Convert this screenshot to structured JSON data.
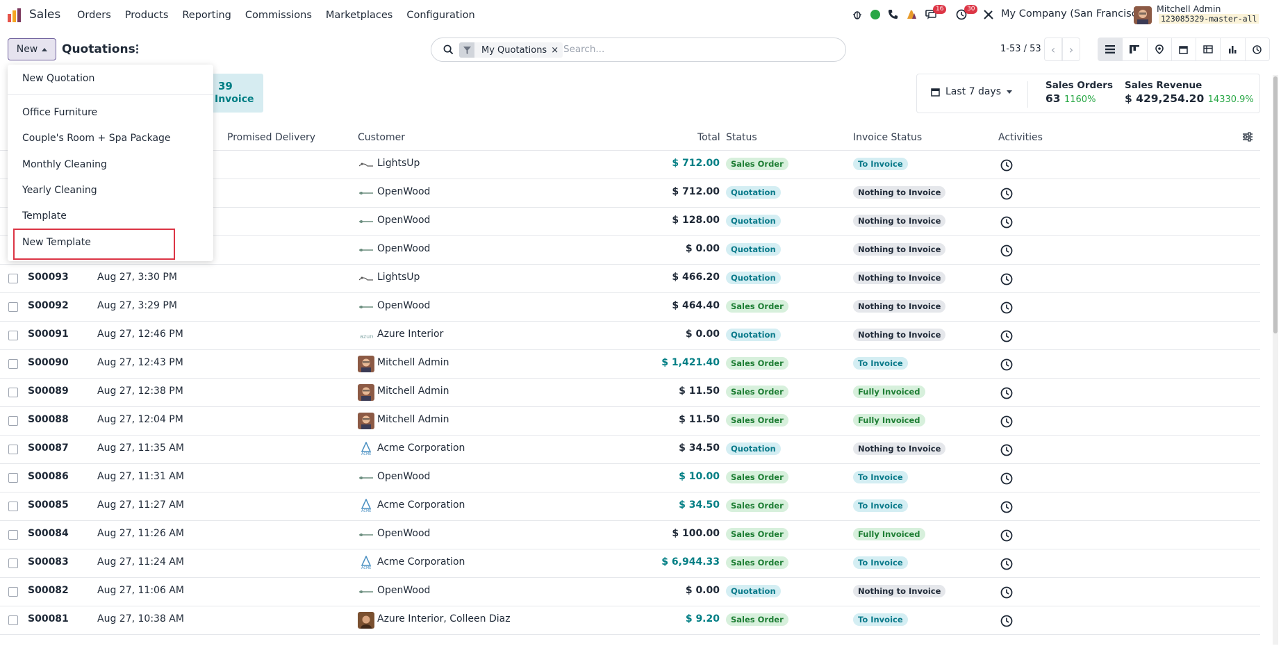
{
  "app": {
    "name": "Sales"
  },
  "menu": [
    "Orders",
    "Products",
    "Reporting",
    "Commissions",
    "Marketplaces",
    "Configuration"
  ],
  "systray": {
    "messages_count": "16",
    "activities_count": "30",
    "company": "My Company (San Francisco)",
    "user": "Mitchell Admin",
    "db": "123085329-master-all"
  },
  "control": {
    "new_label": "New",
    "title": "Quotations"
  },
  "search": {
    "facet": "My Quotations",
    "placeholder": "Search..."
  },
  "pager": {
    "text": "1-53 / 53"
  },
  "kpi": {
    "count": "39",
    "label": "Invoice"
  },
  "stats": {
    "date_filter": "Last 7 days",
    "orders_label": "Sales Orders",
    "orders_value": "63",
    "orders_pct": "1160%",
    "revenue_label": "Sales Revenue",
    "revenue_value": "$ 429,254.20",
    "revenue_pct": "14330.9%"
  },
  "columns": {
    "promised": "Promised Delivery",
    "customer": "Customer",
    "total": "Total",
    "status": "Status",
    "invoice_status": "Invoice Status",
    "activities": "Activities"
  },
  "dropdown": [
    "New Quotation",
    "Office Furniture",
    "Couple's Room + Spa Package",
    "Monthly Cleaning",
    "Yearly Cleaning",
    "Template",
    "New Template"
  ],
  "rows": [
    {
      "num": "",
      "date": "",
      "customer": "LightsUp",
      "logo": "lightsup",
      "total": "$ 712.00",
      "blue": true,
      "status": "Sales Order",
      "inv": "To Invoice"
    },
    {
      "num": "",
      "date": "",
      "customer": "OpenWood",
      "logo": "openwood",
      "total": "$ 712.00",
      "blue": false,
      "status": "Quotation",
      "inv": "Nothing to Invoice"
    },
    {
      "num": "",
      "date": "",
      "customer": "OpenWood",
      "logo": "openwood",
      "total": "$ 128.00",
      "blue": false,
      "status": "Quotation",
      "inv": "Nothing to Invoice"
    },
    {
      "num": "",
      "date": "",
      "customer": "OpenWood",
      "logo": "openwood",
      "total": "$ 0.00",
      "blue": false,
      "status": "Quotation",
      "inv": "Nothing to Invoice"
    },
    {
      "num": "S00093",
      "date": "Aug 27, 3:30 PM",
      "customer": "LightsUp",
      "logo": "lightsup",
      "total": "$ 466.20",
      "blue": false,
      "status": "Quotation",
      "inv": "Nothing to Invoice"
    },
    {
      "num": "S00092",
      "date": "Aug 27, 3:29 PM",
      "customer": "OpenWood",
      "logo": "openwood",
      "total": "$ 464.40",
      "blue": false,
      "status": "Sales Order",
      "inv": "Nothing to Invoice"
    },
    {
      "num": "S00091",
      "date": "Aug 27, 12:46 PM",
      "customer": "Azure Interior",
      "logo": "azure",
      "total": "$ 0.00",
      "blue": false,
      "status": "Quotation",
      "inv": "Nothing to Invoice"
    },
    {
      "num": "S00090",
      "date": "Aug 27, 12:43 PM",
      "customer": "Mitchell Admin",
      "logo": "avatar",
      "total": "$ 1,421.40",
      "blue": true,
      "status": "Sales Order",
      "inv": "To Invoice"
    },
    {
      "num": "S00089",
      "date": "Aug 27, 12:38 PM",
      "customer": "Mitchell Admin",
      "logo": "avatar",
      "total": "$ 11.50",
      "blue": false,
      "status": "Sales Order",
      "inv": "Fully Invoiced"
    },
    {
      "num": "S00088",
      "date": "Aug 27, 12:04 PM",
      "customer": "Mitchell Admin",
      "logo": "avatar",
      "total": "$ 11.50",
      "blue": false,
      "status": "Sales Order",
      "inv": "Fully Invoiced"
    },
    {
      "num": "S00087",
      "date": "Aug 27, 11:35 AM",
      "customer": "Acme Corporation",
      "logo": "acme",
      "total": "$ 34.50",
      "blue": false,
      "status": "Quotation",
      "inv": "Nothing to Invoice"
    },
    {
      "num": "S00086",
      "date": "Aug 27, 11:31 AM",
      "customer": "OpenWood",
      "logo": "openwood",
      "total": "$ 10.00",
      "blue": true,
      "status": "Sales Order",
      "inv": "To Invoice"
    },
    {
      "num": "S00085",
      "date": "Aug 27, 11:27 AM",
      "customer": "Acme Corporation",
      "logo": "acme",
      "total": "$ 34.50",
      "blue": true,
      "status": "Sales Order",
      "inv": "To Invoice"
    },
    {
      "num": "S00084",
      "date": "Aug 27, 11:26 AM",
      "customer": "OpenWood",
      "logo": "openwood",
      "total": "$ 100.00",
      "blue": false,
      "status": "Sales Order",
      "inv": "Fully Invoiced"
    },
    {
      "num": "S00083",
      "date": "Aug 27, 11:24 AM",
      "customer": "Acme Corporation",
      "logo": "acme",
      "total": "$ 6,944.33",
      "blue": true,
      "status": "Sales Order",
      "inv": "To Invoice"
    },
    {
      "num": "S00082",
      "date": "Aug 27, 11:06 AM",
      "customer": "OpenWood",
      "logo": "openwood",
      "total": "$ 0.00",
      "blue": false,
      "status": "Quotation",
      "inv": "Nothing to Invoice"
    },
    {
      "num": "S00081",
      "date": "Aug 27, 10:38 AM",
      "customer": "Azure Interior, Colleen Diaz",
      "logo": "avatar2",
      "total": "$ 9.20",
      "blue": true,
      "status": "Sales Order",
      "inv": "To Invoice"
    }
  ]
}
